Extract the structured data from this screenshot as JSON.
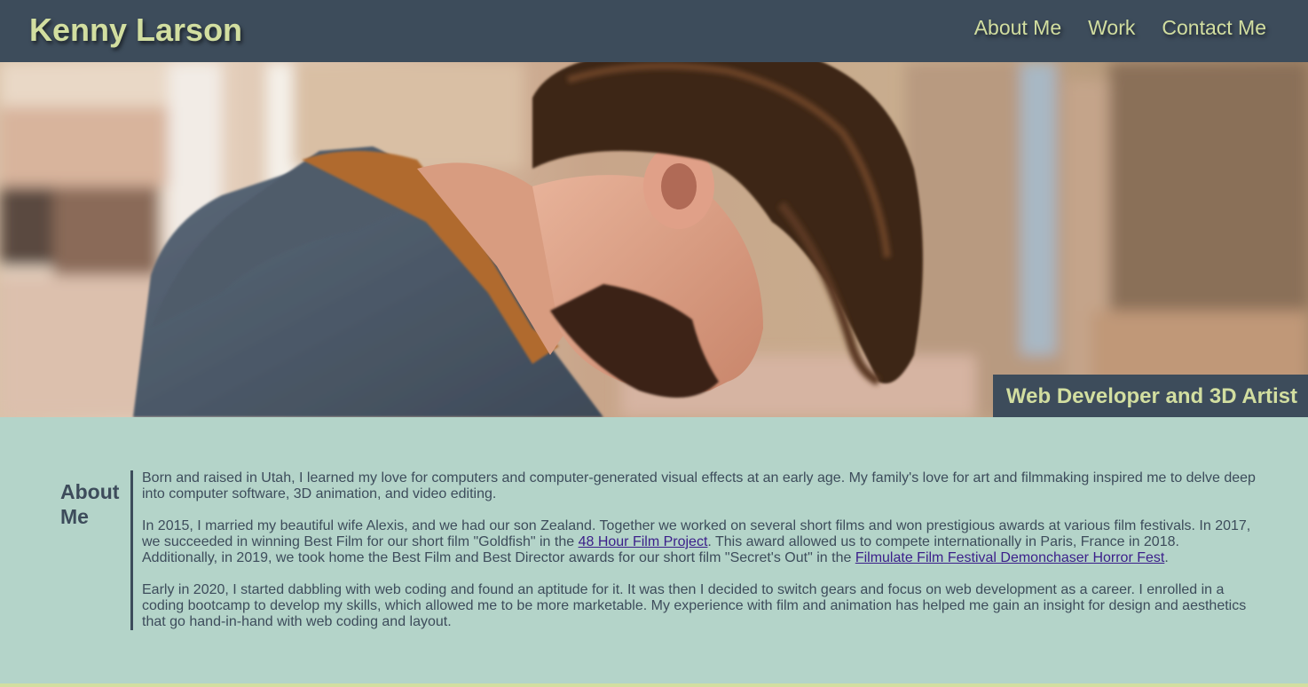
{
  "header": {
    "title": "Kenny Larson",
    "nav": [
      {
        "label": "About Me"
      },
      {
        "label": "Work"
      },
      {
        "label": "Contact Me"
      }
    ]
  },
  "hero": {
    "caption": "Web Developer and 3D Artist"
  },
  "about": {
    "heading": "About Me",
    "p1": "Born and raised in Utah, I learned my love for computers and computer-generated visual effects at an early age. My family's love for art and filmmaking inspired me to delve deep into computer software, 3D animation, and video editing.",
    "p2_a": "In 2015, I married my beautiful wife Alexis, and we had our son Zealand. Together we worked on several short films and won prestigious awards at various film festivals. In 2017, we succeeded in winning Best Film for our short film \"Goldfish\" in the ",
    "p2_link1": "48 Hour Film Project",
    "p2_b": ". This award allowed us to compete internationally in Paris, France in 2018. Additionally, in 2019, we took home the Best Film and Best Director awards for our short film \"Secret's Out\" in the ",
    "p2_link2": "Filmulate Film Festival Demonchaser Horror Fest",
    "p2_c": ".",
    "p3": "Early in 2020, I started dabbling with web coding and found an aptitude for it. It was then I decided to switch gears and focus on web development as a career. I enrolled in a coding bootcamp to develop my skills, which allowed me to be more marketable. My experience with film and animation has helped me gain an insight for design and aesthetics that go hand-in-hand with web coding and layout."
  },
  "colors": {
    "header_bg": "#3d4c5b",
    "accent": "#d2dea0",
    "content_bg": "#b4d4c9",
    "link": "#3b1f8a"
  }
}
